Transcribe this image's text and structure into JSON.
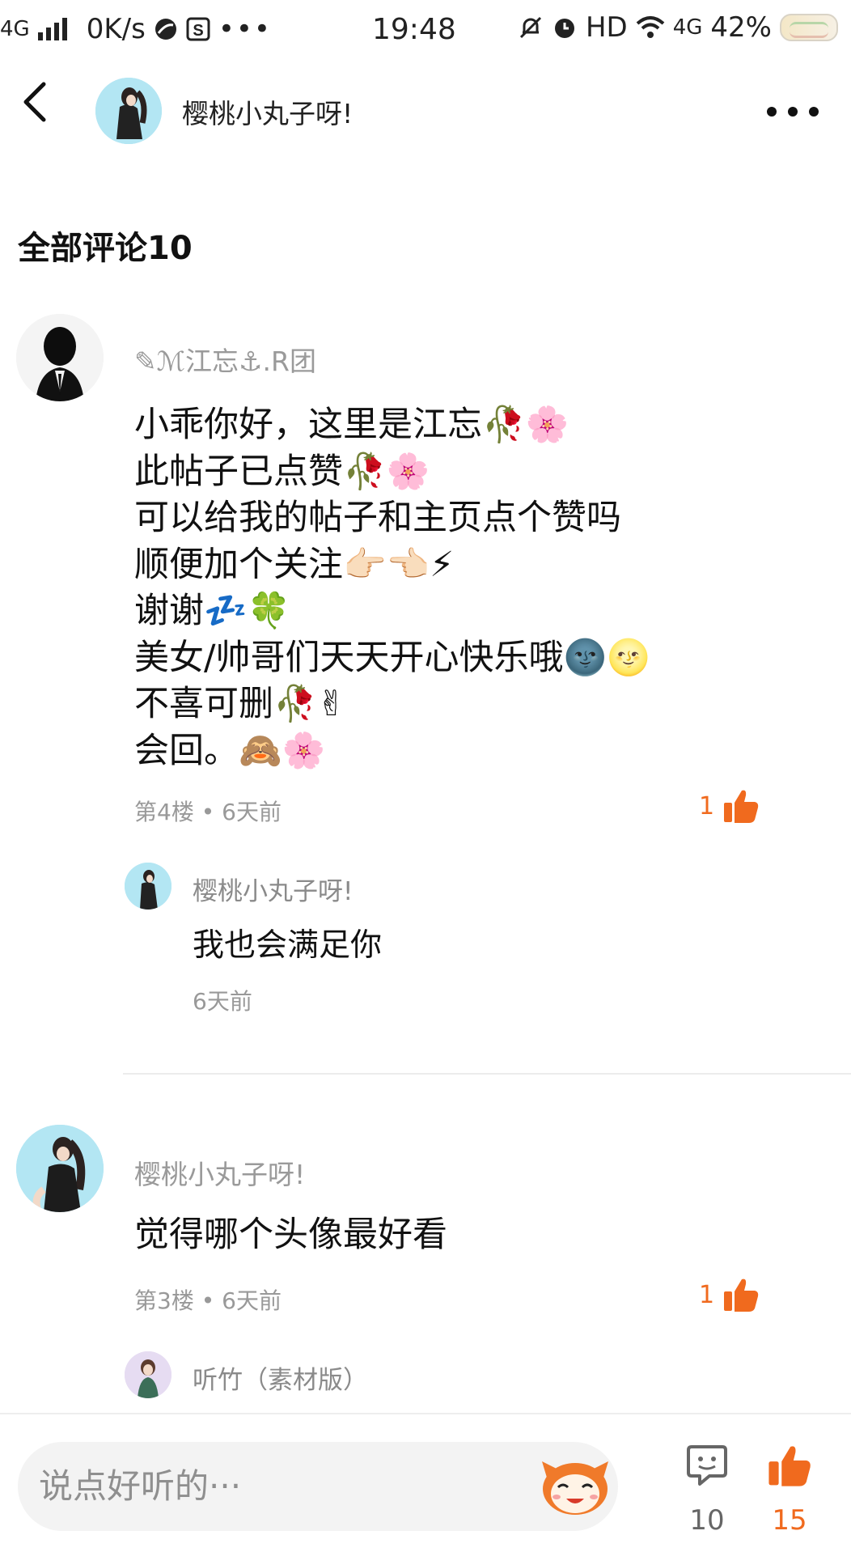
{
  "status_bar": {
    "network": "4G",
    "speed": "0K/s",
    "time": "19:48",
    "hd": "HD",
    "net_right": "4G",
    "battery": "42%"
  },
  "header": {
    "username": "樱桃小丸子呀!"
  },
  "comments_section": {
    "title": "全部评论10"
  },
  "comments": [
    {
      "username": "✎ℳ江忘⚓.R团",
      "lines": [
        "小乖你好，这里是江忘🥀🌸",
        "此帖子已点赞🥀🌸",
        "可以给我的帖子和主页点个赞吗",
        "顺便加个关注👉🏻👈🏻⚡",
        "谢谢💤🍀",
        "美女/帅哥们天天开心快乐哦🌚🌝",
        "不喜可删🥀✌",
        "会回。🙈🌸"
      ],
      "meta": "第4楼 • 6天前",
      "likes": "1",
      "reply": {
        "username": "樱桃小丸子呀!",
        "text": "我也会满足你",
        "time": "6天前"
      }
    },
    {
      "username": "樱桃小丸子呀!",
      "text": "觉得哪个头像最好看",
      "meta": "第3楼 • 6天前",
      "likes": "1",
      "reply_preview_user": "听竹（素材版）"
    }
  ],
  "bottom_bar": {
    "input_placeholder": "说点好听的···",
    "comment_count": "10",
    "like_count": "15"
  },
  "colors": {
    "accent": "#f06a1e",
    "muted": "#999999"
  }
}
